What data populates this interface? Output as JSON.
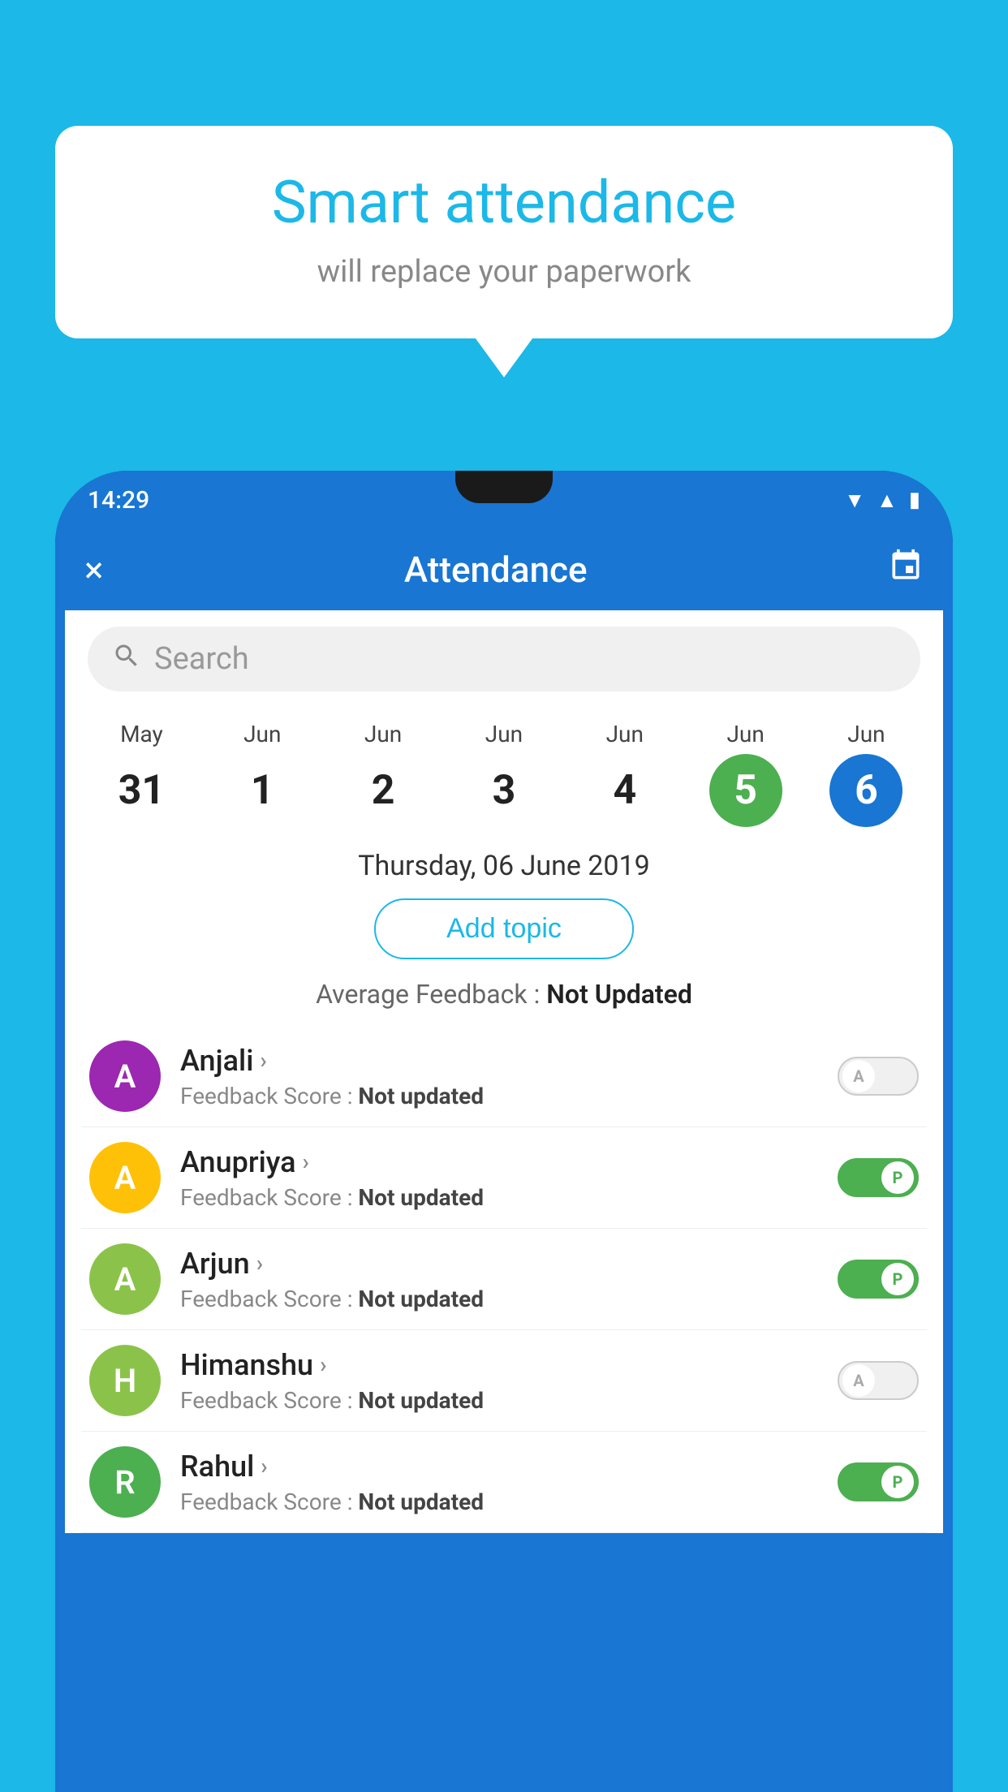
{
  "background_color": "#1BB8E8",
  "bubble": {
    "title": "Smart attendance",
    "subtitle": "will replace your paperwork"
  },
  "status_bar": {
    "time": "14:29",
    "icons": [
      "wifi",
      "signal",
      "battery"
    ]
  },
  "top_bar": {
    "title": "Attendance",
    "close_label": "×",
    "calendar_label": "📅"
  },
  "search": {
    "placeholder": "Search"
  },
  "calendar": {
    "days": [
      {
        "month": "May",
        "num": "31",
        "style": "normal"
      },
      {
        "month": "Jun",
        "num": "1",
        "style": "normal"
      },
      {
        "month": "Jun",
        "num": "2",
        "style": "normal"
      },
      {
        "month": "Jun",
        "num": "3",
        "style": "normal"
      },
      {
        "month": "Jun",
        "num": "4",
        "style": "normal"
      },
      {
        "month": "Jun",
        "num": "5",
        "style": "green"
      },
      {
        "month": "Jun",
        "num": "6",
        "style": "blue"
      }
    ]
  },
  "selected_date": "Thursday, 06 June 2019",
  "add_topic_label": "Add topic",
  "avg_feedback_label": "Average Feedback : ",
  "avg_feedback_value": "Not Updated",
  "students": [
    {
      "name": "Anjali",
      "initial": "A",
      "avatar_color": "#9C27B0",
      "feedback": "Not updated",
      "status": "absent"
    },
    {
      "name": "Anupriya",
      "initial": "A",
      "avatar_color": "#FFC107",
      "feedback": "Not updated",
      "status": "present"
    },
    {
      "name": "Arjun",
      "initial": "A",
      "avatar_color": "#8BC34A",
      "feedback": "Not updated",
      "status": "present"
    },
    {
      "name": "Himanshu",
      "initial": "H",
      "avatar_color": "#8BC34A",
      "feedback": "Not updated",
      "status": "absent"
    },
    {
      "name": "Rahul",
      "initial": "R",
      "avatar_color": "#4CAF50",
      "feedback": "Not updated",
      "status": "present"
    }
  ]
}
